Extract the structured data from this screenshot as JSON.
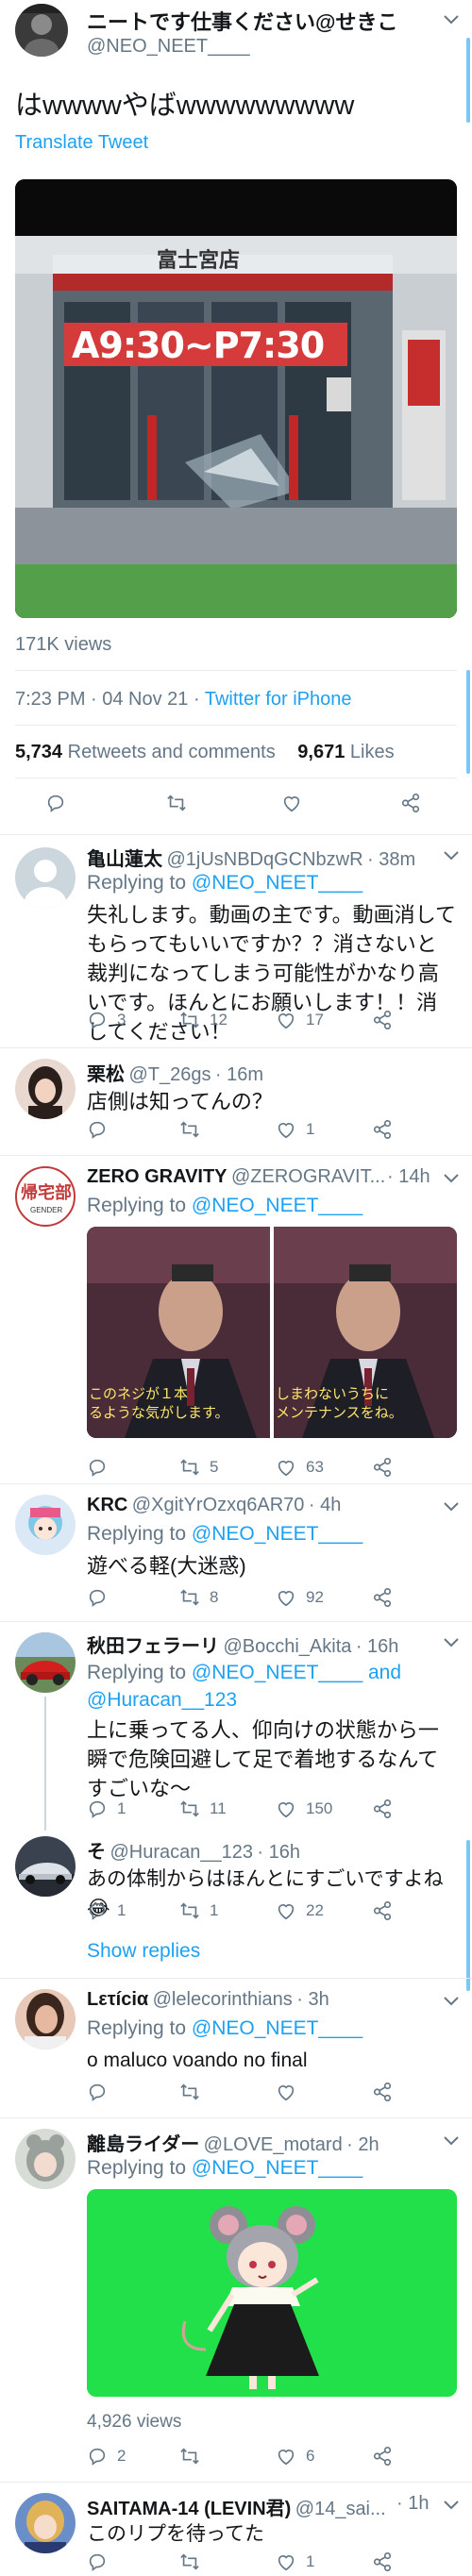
{
  "main_tweet": {
    "author_name": "ニートです仕事ください@せきこ",
    "author_handle": "@NEO_NEET____",
    "text": "はwwwwやばwwwwwwwww",
    "translate": "Translate Tweet",
    "image": {
      "sign": "富士宮店",
      "hours": "A9:30~P7:30"
    },
    "views": "171K views",
    "timestamp": "7:23 PM · 04 Nov 21 · ",
    "client": "Twitter for iPhone",
    "retweets_count": "5,734",
    "retweets_label": " Retweets and comments",
    "likes_count": "9,671",
    "likes_label": " Likes"
  },
  "replies": [
    {
      "name": "亀山蓮太",
      "handle": "@1jUsNBDqGCNbzwR",
      "time": "· 38m",
      "replying": "Replying to ",
      "replying_to": "@NEO_NEET____",
      "text": "失礼します。動画の主です。動画消してもらってもいいですか？？消さないと裁判になってしまう可能性がかなり高いです。ほんとにお願いします！！消してください！",
      "replies": "3",
      "retweets": "12",
      "likes": "17"
    },
    {
      "name": "栗松",
      "handle": "@T_26gs",
      "time": "· 16m",
      "text": "店側は知ってんの？",
      "likes": "1"
    },
    {
      "name": "ZERO GRAVITY",
      "handle": "@ZEROGRAVIT...",
      "time": "· 14h",
      "replying": "Replying to ",
      "replying_to": "@NEO_NEET____",
      "avatar_text": "帰宅部",
      "avatar_sub": "GENDER",
      "caption_left": "このネジが１本\nるような気がします。",
      "caption_right": "しまわないうちに\nメンテナンスをね。",
      "retweets": "5",
      "likes": "63"
    },
    {
      "name": "KRC",
      "handle": "@XgitYrOzxq6AR70",
      "time": "· 4h",
      "replying": "Replying to ",
      "replying_to": "@NEO_NEET____",
      "text": "遊べる軽(大迷惑)",
      "retweets": "8",
      "likes": "92"
    },
    {
      "name": "秋田フェラーリ",
      "handle": "@Bocchi_Akita",
      "time": "· 16h",
      "replying": "Replying to ",
      "replying_to": "@NEO_NEET____",
      "replying_and": " and",
      "replying_to2": "@Huracan__123",
      "text": "上に乗ってる人、仰向けの状態から一瞬で危険回避して足で着地するなんてすごいな〜",
      "replies": "1",
      "retweets": "11",
      "likes": "150"
    },
    {
      "name": "そ",
      "handle": "@Huracan__123",
      "time": "· 16h",
      "text": "あの体制からはほんとにすごいですよね😂",
      "replies": "1",
      "retweets": "1",
      "likes": "22",
      "show_replies": "Show replies"
    },
    {
      "name": "Lετíciα",
      "handle": "@lelecorinthians",
      "time": "· 3h",
      "replying": "Replying to ",
      "replying_to": "@NEO_NEET____",
      "text": "o maluco voando no final",
      "replies": "",
      "retweets": "",
      "likes": ""
    },
    {
      "name": "離島ライダー",
      "handle": "@LOVE_motard",
      "time": "· 2h",
      "replying": "Replying to ",
      "replying_to": "@NEO_NEET____",
      "views": "4,926 views",
      "replies": "2",
      "likes": "6"
    },
    {
      "name": "SAITAMA-14 (LEVIN君)",
      "handle": "@14_sai...",
      "time": "· 1h",
      "text": "このリプを待ってた",
      "likes": "1"
    }
  ],
  "colors": {
    "accent": "#1da1f2",
    "muted": "#657786",
    "divider": "#e6ecf0",
    "green_screen": "#22e04a"
  }
}
